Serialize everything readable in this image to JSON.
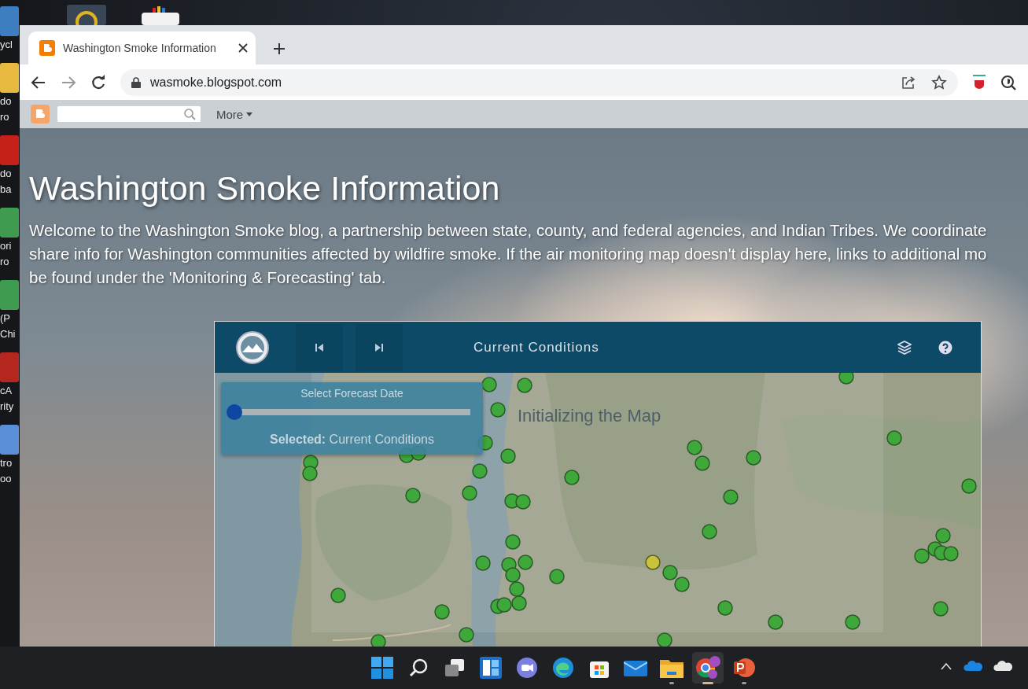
{
  "desktop": {
    "top_icons": [
      {
        "kind": "app"
      },
      {
        "kind": "printer"
      }
    ],
    "side_items": [
      {
        "kind": "recycle",
        "lines": [
          "ycl"
        ]
      },
      {
        "kind": "folder",
        "lines": [
          "do",
          "ro"
        ]
      },
      {
        "kind": "pdf",
        "lines": [
          "do",
          "ba"
        ]
      },
      {
        "kind": "chrome",
        "lines": [
          "ori",
          "ro"
        ]
      },
      {
        "kind": "chrome",
        "lines": [
          "(P",
          "Chi"
        ]
      },
      {
        "kind": "app",
        "lines": [
          "cA",
          "rity"
        ]
      },
      {
        "kind": "doc",
        "lines": [
          "tro",
          "oo"
        ]
      }
    ]
  },
  "browser": {
    "tabs": [
      {
        "title": "Washington Smoke Information",
        "selected": true
      }
    ],
    "address": "wasmoke.blogspot.com",
    "navbar": {
      "more": "More"
    }
  },
  "blog": {
    "title": "Washington Smoke Information",
    "description_lines": [
      "Welcome to the Washington Smoke blog, a partnership between state, county, and federal agencies, and Indian Tribes. We coordinate",
      "share info for Washington communities affected by wildfire smoke. If the air monitoring map doesn't display here, links to additional mo",
      "be found under the 'Monitoring & Forecasting' tab."
    ]
  },
  "map": {
    "header_title": "Current Conditions",
    "loading": "Initializing the Map",
    "forecast": {
      "label": "Select Forecast Date",
      "level": 0,
      "selected_label": "Selected:",
      "selected_value": "Current Conditions"
    }
  },
  "taskbar": {
    "apps": [
      {
        "kind": "start",
        "running": false
      },
      {
        "kind": "search",
        "running": false
      },
      {
        "kind": "taskview",
        "running": false
      },
      {
        "kind": "widgets",
        "running": false
      },
      {
        "kind": "chat",
        "running": false
      },
      {
        "kind": "edge",
        "running": false
      },
      {
        "kind": "store",
        "running": false
      },
      {
        "kind": "mail",
        "running": false
      },
      {
        "kind": "explorer",
        "running": true
      },
      {
        "kind": "chrome",
        "running": true,
        "selected": true
      },
      {
        "kind": "powerpoint",
        "running": true
      }
    ],
    "tray": [
      {
        "kind": "caret"
      },
      {
        "kind": "onedrive"
      },
      {
        "kind": "cloud"
      }
    ]
  }
}
